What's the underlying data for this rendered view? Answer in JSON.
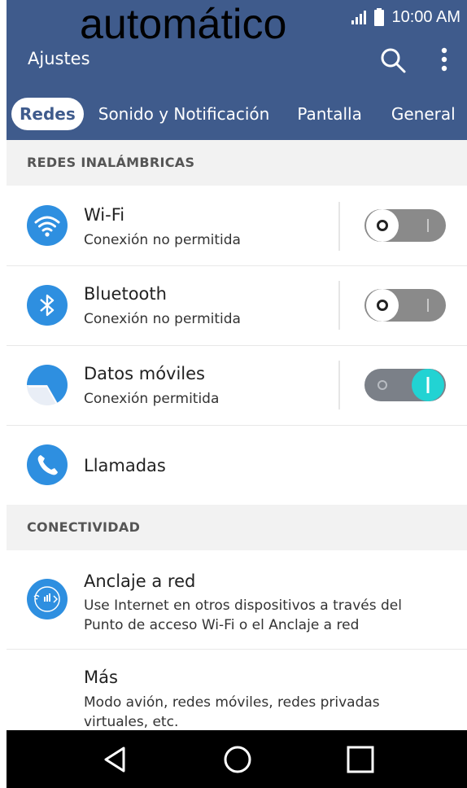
{
  "overlay_label": "automático",
  "status_bar": {
    "time": "10:00 AM",
    "icons": [
      "signal-icon",
      "battery-icon"
    ]
  },
  "app_bar": {
    "title": "Ajustes",
    "actions": [
      "search-icon",
      "more-vert-icon"
    ]
  },
  "tabs": [
    "Redes",
    "Sonido y Notificación",
    "Pantalla",
    "General"
  ],
  "sections": {
    "wireless": "REDES INALÁMBRICAS",
    "connectivity": "CONECTIVIDAD"
  },
  "items": [
    {
      "title": "Wi-Fi",
      "subtitle": "Conexión no permitida",
      "icon": "wifi-icon",
      "toggle_on": false
    },
    {
      "title": "Bluetooth",
      "subtitle": "Conexión no permitida",
      "icon": "bluetooth-icon",
      "toggle_on": false
    },
    {
      "title": "Datos móviles",
      "subtitle": "Conexión permitida",
      "icon": "mobile-data-icon",
      "toggle_on": true
    },
    {
      "title": "Llamadas",
      "icon": "phone-icon"
    },
    {
      "title": "Anclaje a red",
      "subtitle": "Use Internet en otros dispositivos a través del Punto de acceso Wi-Fi o el Anclaje a red",
      "icon": "tethering-icon"
    },
    {
      "title": "Más",
      "subtitle": "Modo avión, redes móviles, redes privadas virtuales, etc."
    }
  ],
  "nav": [
    "back-icon",
    "home-icon",
    "recents-icon"
  ],
  "colors": {
    "primary": "#3f5b8c",
    "accent": "#2eaef0",
    "toggle_on_knob": "#22d3d3"
  }
}
